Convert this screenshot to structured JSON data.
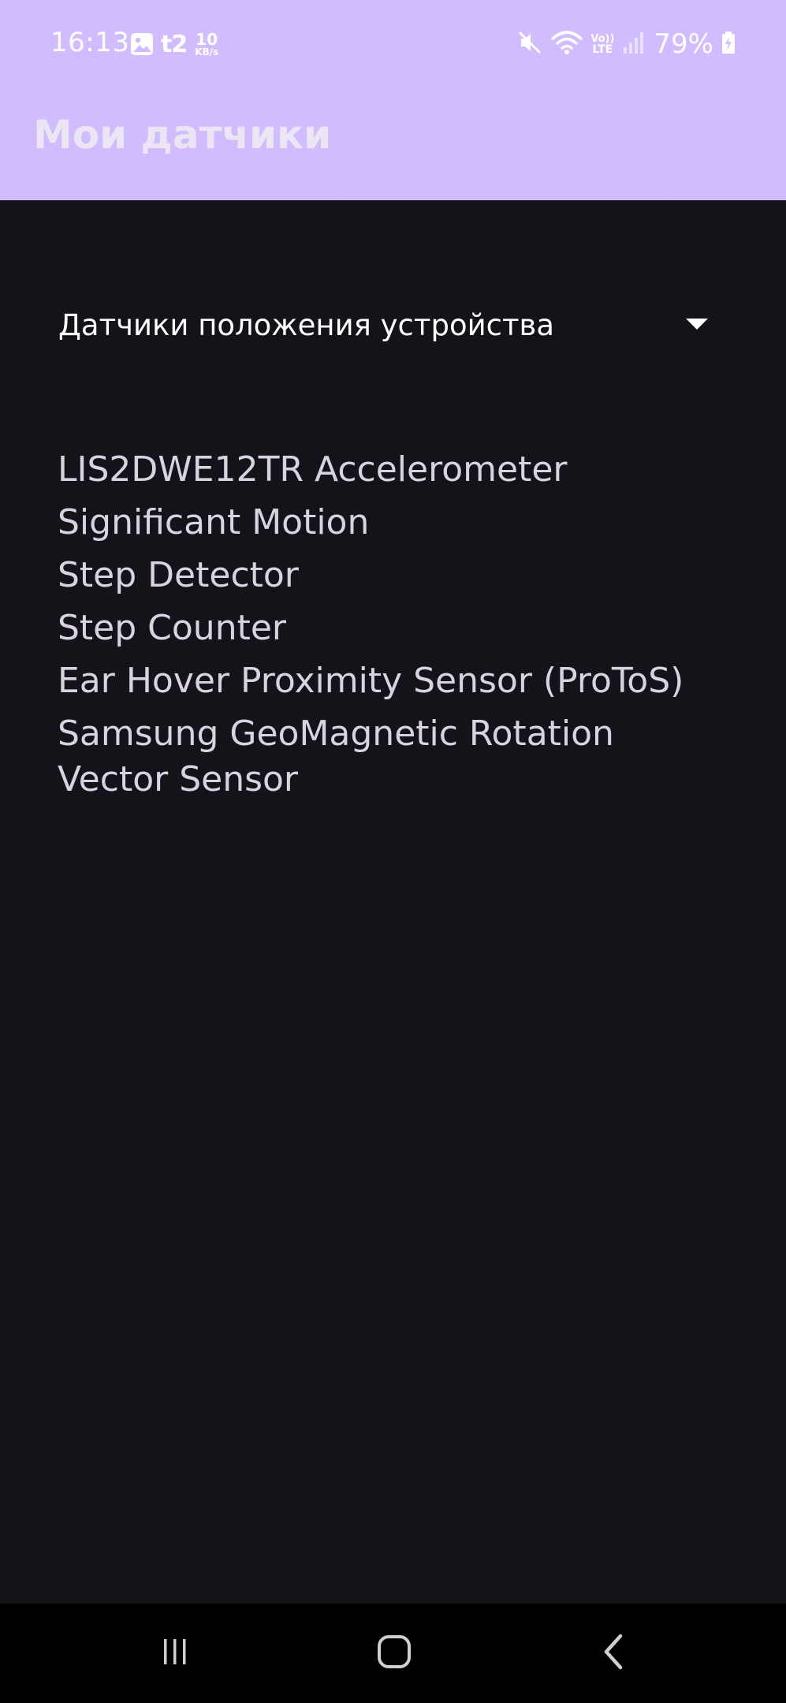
{
  "status_bar": {
    "time": "16:13",
    "carrier_logo": "t2",
    "net_speed_value": "10",
    "net_speed_unit": "KB/s",
    "volte_top": "Vo))",
    "volte_bottom": "LTE",
    "battery_percent": "79%",
    "icons": [
      "gallery-icon",
      "carrier-t2-icon",
      "mute-icon",
      "wifi-icon",
      "volte-icon",
      "signal-icon",
      "battery-charging-icon"
    ]
  },
  "app_bar": {
    "title": "Мои датчики"
  },
  "spinner": {
    "selected": "Датчики положения устройства",
    "icon": "dropdown-arrow-icon"
  },
  "sensors": [
    "LIS2DWE12TR Accelerometer",
    "Significant Motion",
    "Step Detector",
    "Step Counter",
    "Ear Hover Proximity Sensor (ProToS)",
    "Samsung GeoMagnetic Rotation Vector Sensor"
  ],
  "nav_bar": {
    "icons": [
      "recents-icon",
      "home-icon",
      "back-icon"
    ]
  },
  "colors": {
    "app_bar_bg": "#d0bcff",
    "content_bg": "#15131a",
    "nav_bg": "#000000",
    "text_primary": "#ffffff",
    "text_list": "#d9d3df"
  }
}
